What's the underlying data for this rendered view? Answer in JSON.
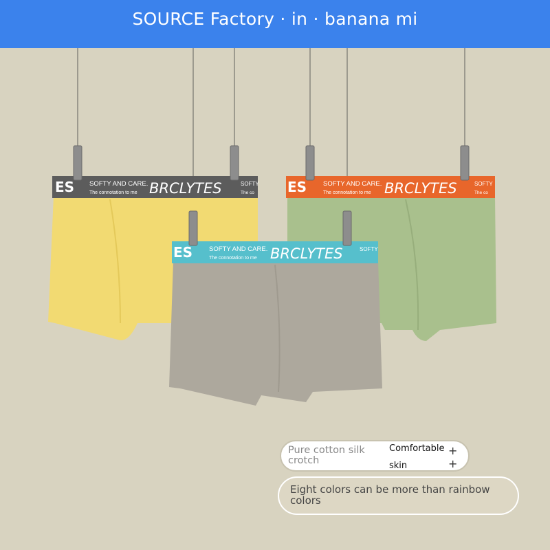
{
  "header": {
    "title": "SOURCE Factory · in · banana mi"
  },
  "products": [
    {
      "brand": "BRCLYTES",
      "tagline": "SOFTY AND CARE.",
      "subline": "The connotation to me",
      "fragment": "ES",
      "waistband_color": "#5c5c5c",
      "body_color": "#f2da72"
    },
    {
      "brand": "BRCLYTES",
      "tagline": "SOFTY AND CARE.",
      "subline": "The connotation to me",
      "fragment": "ES",
      "waistband_color": "#e8662b",
      "body_color": "#a9c08d"
    },
    {
      "brand": "BRCLYTES",
      "tagline": "SOFTY AND CARE.",
      "subline": "The connotation to me",
      "fragment": "ES",
      "waistband_color": "#56bfcc",
      "body_color": "#ada89d"
    }
  ],
  "edge_tags": [
    "SOFTY",
    "The co",
    "SOFTY",
    "The co"
  ],
  "features": {
    "badge1_text": "Pure cotton silk crotch",
    "badge1_side_line1": "Comfortable",
    "badge1_side_line2": "skin",
    "badge1_plus": "+ +",
    "badge2_text": "Eight colors can be more than rainbow colors"
  }
}
